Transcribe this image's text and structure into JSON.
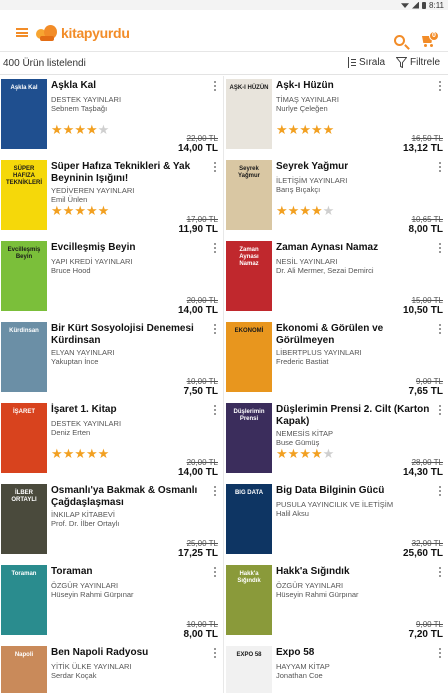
{
  "status_bar": {
    "time": "8:11"
  },
  "header": {
    "logo_text": "kitapyurdu",
    "cart_count": "0",
    "icons": {
      "menu": "hamburger-icon",
      "search": "search-icon",
      "cart": "cart-icon"
    },
    "brand_color": "#f28c28"
  },
  "toolbar": {
    "result_count": "400 Ürün listelendi",
    "sort_label": "Sırala",
    "filter_label": "Filtrele"
  },
  "products": [
    {
      "title": "Aşkla Kal",
      "publisher": "DESTEK YAYINLARI",
      "author": "Sebnem Taşbağı",
      "rating": 4,
      "old_price": "22,00 TL",
      "price": "14,00 TL",
      "cover_color": "#1f4f8f",
      "cover_text": "Aşkla Kal"
    },
    {
      "title": "Aşk-ı Hüzün",
      "publisher": "TİMAŞ YAYINLARI",
      "author": "Nurlye Çeleğen",
      "rating": 5,
      "old_price": "16,50 TL",
      "price": "13,12 TL",
      "cover_color": "#e8e4dc",
      "cover_text": "AŞK-I HÜZÜN"
    },
    {
      "title": "Süper Hafıza Teknikleri & Yak Beyninin Işığını!",
      "publisher": "YEDİVEREN YAYINLARI",
      "author": "Emil Ünlen",
      "rating": 5,
      "old_price": "17,00 TL",
      "price": "11,90 TL",
      "cover_color": "#f5d80a",
      "cover_text": "SÜPER HAFIZA TEKNİKLERİ"
    },
    {
      "title": "Seyrek Yağmur",
      "publisher": "İLETİŞİM YAYINLARI",
      "author": "Barış Bıçakçı",
      "rating": 4,
      "old_price": "10,65 TL",
      "price": "8,00 TL",
      "cover_color": "#d9c7a3",
      "cover_text": "Seyrek Yağmur"
    },
    {
      "title": "Evcilleşmiş Beyin",
      "publisher": "YAPI KREDİ YAYINLARI",
      "author": "Bruce Hood",
      "rating": 0,
      "old_price": "20,00 TL",
      "price": "14,00 TL",
      "cover_color": "#7bbf3a",
      "cover_text": "Evcilleşmiş Beyin"
    },
    {
      "title": "Zaman Aynası Namaz",
      "publisher": "NESİL YAYINLARI",
      "author": "Dr. Ali Mermer, Sezai Demirci",
      "rating": 0,
      "old_price": "15,00 TL",
      "price": "10,50 TL",
      "cover_color": "#c0282d",
      "cover_text": "Zaman Aynası Namaz"
    },
    {
      "title": "Bir Kürt Sosyolojisi Denemesi Kürdinsan",
      "publisher": "ELYAN YAYINLARI",
      "author": "Yakuptan İnce",
      "rating": 0,
      "old_price": "10,00 TL",
      "price": "7,50 TL",
      "cover_color": "#6b8fa6",
      "cover_text": "Kürdinsan"
    },
    {
      "title": "Ekonomi & Görülen ve Görülmeyen",
      "publisher": "LİBERTPLUS YAYINLARI",
      "author": "Frederic Bastiat",
      "rating": 0,
      "old_price": "9,00 TL",
      "price": "7,65 TL",
      "cover_color": "#e8961e",
      "cover_text": "EKONOMİ"
    },
    {
      "title": "İşaret 1. Kitap",
      "publisher": "DESTEK YAYINLARI",
      "author": "Deniz Erten",
      "rating": 5,
      "old_price": "20,00 TL",
      "price": "14,00 TL",
      "cover_color": "#d8431e",
      "cover_text": "İŞARET"
    },
    {
      "title": "Düşlerimin Prensi 2. Cilt (Karton Kapak)",
      "publisher": "NEMESİS KİTAP",
      "author": "Buse Gümüş",
      "rating": 4,
      "old_price": "28,00 TL",
      "price": "14,30 TL",
      "cover_color": "#3b2d5c",
      "cover_text": "Düşlerimin Prensi"
    },
    {
      "title": "Osmanlı'ya Bakmak & Osmanlı Çağdaşlaşması",
      "publisher": "İNKILAP KİTABEVİ",
      "author": "Prof. Dr. İlber Ortaylı",
      "rating": 0,
      "old_price": "25,00 TL",
      "price": "17,25 TL",
      "cover_color": "#4a4a3c",
      "cover_text": "İLBER ORTAYLI"
    },
    {
      "title": "Big Data Bilginin Gücü",
      "publisher": "PUSULA YAYINCILIK VE İLETİŞİM",
      "author": "Halil Aksu",
      "rating": 0,
      "old_price": "32,00 TL",
      "price": "25,60 TL",
      "cover_color": "#0e3563",
      "cover_text": "BIG DATA"
    },
    {
      "title": "Toraman",
      "publisher": "ÖZGÜR YAYINLARI",
      "author": "Hüseyin Rahmi Gürpınar",
      "rating": 0,
      "old_price": "10,00 TL",
      "price": "8,00 TL",
      "cover_color": "#2a8c8e",
      "cover_text": "Toraman"
    },
    {
      "title": "Hakk'a Sığındık",
      "publisher": "ÖZGÜR YAYINLARI",
      "author": "Hüseyin Rahmi Gürpınar",
      "rating": 0,
      "old_price": "9,00 TL",
      "price": "7,20 TL",
      "cover_color": "#8a9a3a",
      "cover_text": "Hakk'a Sığındık"
    },
    {
      "title": "Ben Napoli Radyosu",
      "publisher": "YİTİK ÜLKE YAYINLARI",
      "author": "Serdar Koçak",
      "rating": 0,
      "old_price": "",
      "price": "",
      "cover_color": "#c98a5a",
      "cover_text": "Napoli"
    },
    {
      "title": "Expo 58",
      "publisher": "HAYYAM KİTAP",
      "author": "Jonathan Coe",
      "rating": 0,
      "old_price": "",
      "price": "",
      "cover_color": "#f1f1f1",
      "cover_text": "EXPO 58"
    }
  ]
}
